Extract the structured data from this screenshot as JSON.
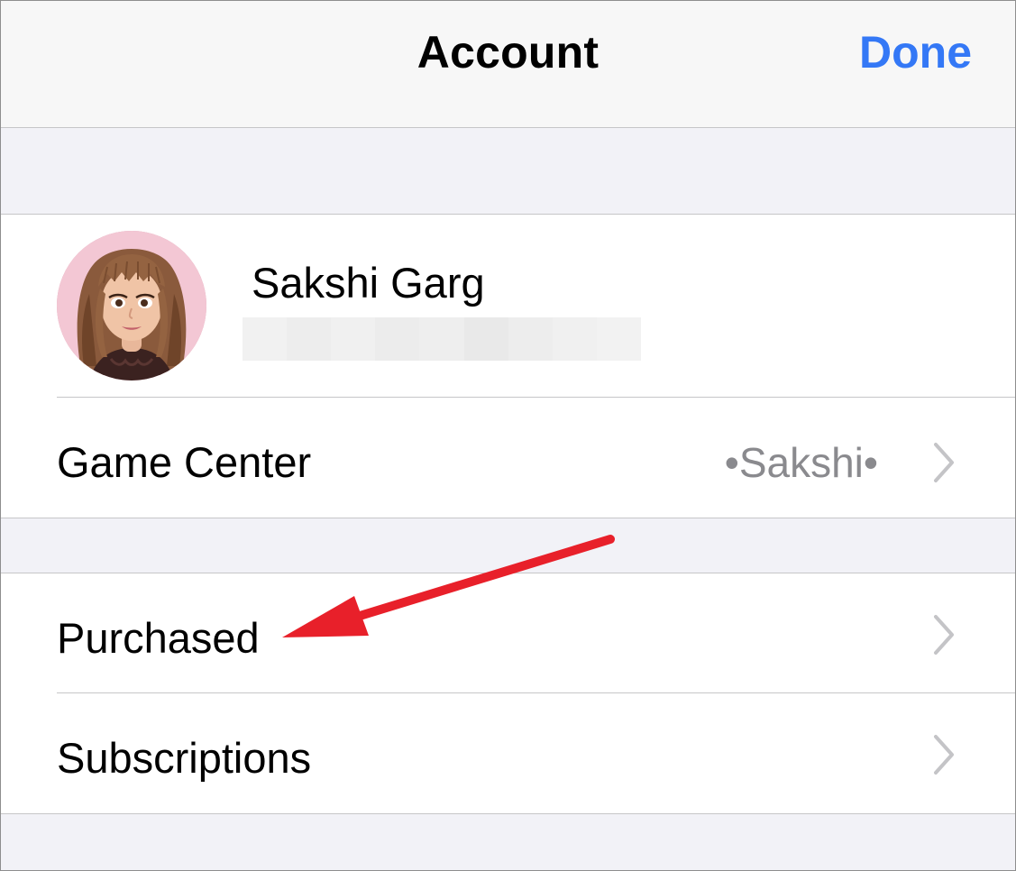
{
  "navbar": {
    "title": "Account",
    "done_label": "Done"
  },
  "profile": {
    "name": "Sakshi Garg",
    "email_redacted": true
  },
  "rows": {
    "game_center": {
      "label": "Game Center",
      "value": "•Sakshi•"
    },
    "purchased": {
      "label": "Purchased"
    },
    "subscriptions": {
      "label": "Subscriptions"
    }
  },
  "icons": {
    "chevron": "chevron-right-icon",
    "avatar": "memoji-avatar"
  },
  "colors": {
    "accent": "#3478f6",
    "annotation_arrow": "#e8202a",
    "grouped_background": "#f2f2f7",
    "secondary_text": "#8a8a8e"
  }
}
